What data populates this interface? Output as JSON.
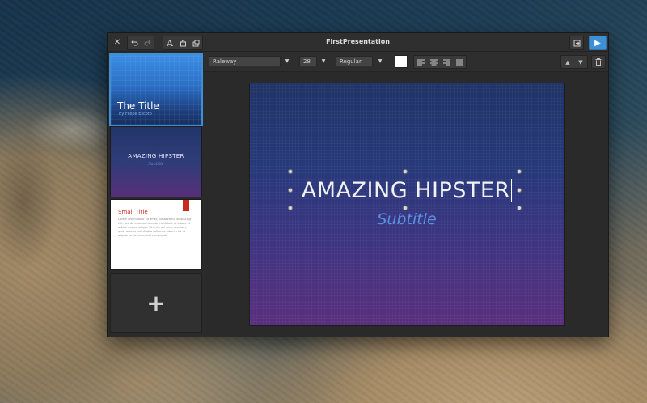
{
  "window": {
    "title": "FirstPresentation",
    "close_icon": "close-icon",
    "undo_icon": "undo-icon",
    "redo_icon": "redo-icon",
    "text_icon": "A",
    "shape_icon": "insert-shape-icon",
    "image_icon": "insert-image-icon",
    "export_icon": "export-icon",
    "play_icon": "play-icon",
    "accent": "#3d8fd6"
  },
  "slides": [
    {
      "title": "The Title",
      "subtitle": "By Felipe Escoto"
    },
    {
      "title": "AMAZING HIPSTER",
      "subtitle": "Subtitle"
    },
    {
      "title": "Small Title",
      "body": "Lorem ipsum dolor sit amet, consectetur adipiscing elit, sed do eiusmod tempor incididunt ut labore et dolore magna aliqua. Ut enim ad minim veniam, quis nostrud exercitation ullamco laboris nisi ut aliquip ex ea commodo consequat."
    }
  ],
  "add_slide_label": "+",
  "toolbar": {
    "font": "Raleway",
    "size": "28",
    "weight": "Regular",
    "text_color": "#ffffff"
  },
  "canvas": {
    "title": "AMAZING HIPSTER",
    "subtitle": "Subtitle",
    "title_color": "#f2f2f2",
    "subtitle_color": "#5b8fe0"
  }
}
